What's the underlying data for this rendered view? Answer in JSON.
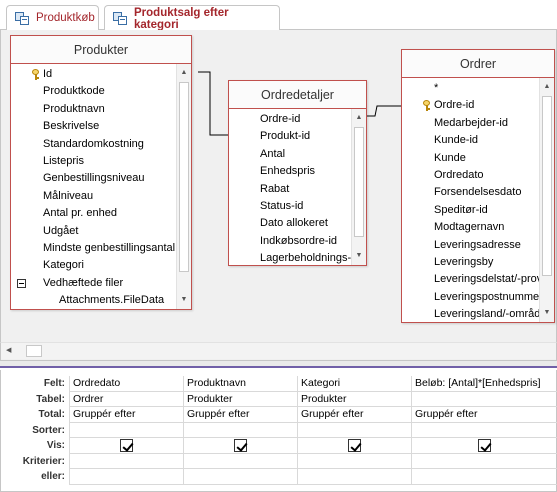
{
  "tabs": [
    {
      "label": "Produktkøb",
      "active": false
    },
    {
      "label": "Produktsalg efter kategori",
      "active": true
    }
  ],
  "tables": {
    "produkter": {
      "title": "Produkter",
      "fields": [
        "Id",
        "Produktkode",
        "Produktnavn",
        "Beskrivelse",
        "Standardomkostning",
        "Listepris",
        "Genbestillingsniveau",
        "Målniveau",
        "Antal pr. enhed",
        "Udgået",
        "Mindste genbestillingsantal",
        "Kategori",
        "Vedhæftede filer",
        "Attachments.FileData"
      ]
    },
    "ordredetaljer": {
      "title": "Ordredetaljer",
      "fields": [
        "Ordre-id",
        "Produkt-id",
        "Antal",
        "Enhedspris",
        "Rabat",
        "Status-id",
        "Dato allokeret",
        "Indkøbsordre-id",
        "Lagerbeholdnings-i"
      ]
    },
    "ordrer": {
      "title": "Ordrer",
      "fields": [
        "*",
        "Ordre-id",
        "Medarbejder-id",
        "Kunde-id",
        "Kunde",
        "Ordredato",
        "Forsendelsesdato",
        "Speditør-id",
        "Modtagernavn",
        "Leveringsadresse",
        "Leveringsby",
        "Leveringsdelstat/-prov",
        "Leveringspostnummer",
        "Leveringsland/-område"
      ]
    }
  },
  "grid": {
    "row_labels": [
      "Felt:",
      "Tabel:",
      "Total:",
      "Sorter:",
      "Vis:",
      "Kriterier:",
      "eller:"
    ],
    "columns": [
      {
        "felt": "Ordredato",
        "tabel": "Ordrer",
        "total": "Gruppér efter",
        "sorter": "",
        "vis": true
      },
      {
        "felt": "Produktnavn",
        "tabel": "Produkter",
        "total": "Gruppér efter",
        "sorter": "",
        "vis": true
      },
      {
        "felt": "Kategori",
        "tabel": "Produkter",
        "total": "Gruppér efter",
        "sorter": "",
        "vis": true
      },
      {
        "felt": "Beløb: [Antal]*[Enhedspris]",
        "tabel": "",
        "total": "Gruppér efter",
        "sorter": "",
        "vis": true
      }
    ]
  },
  "colors": {
    "accent": "#c0504d",
    "tab_text": "#a4262c",
    "splitter": "#7160a8"
  },
  "icons": {
    "primary_key": "key-icon",
    "query_tab": "query-icon"
  }
}
